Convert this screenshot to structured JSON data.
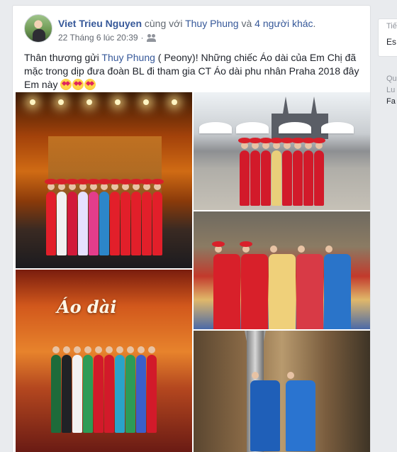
{
  "post": {
    "author": "Viet Trieu Nguyen",
    "with_text": " cùng với ",
    "tagged": "Thuy Phung",
    "and_text": " và ",
    "others": "4 người khác",
    "period": ".",
    "timestamp": "22 Tháng 6 lúc 20:39",
    "dot": " · ",
    "audience_icon": "friends-icon",
    "text_before": "Thân thương gửi ",
    "text_tag": "Thuy Phung",
    "text_after": " ( Peony)! Những chiếc Áo dài của Em Chị đã mặc trong dịp đưa đoàn BL đi tham gia CT Áo dài phu nhân Praha 2018 đây Em này ",
    "emoji_icon": "heart-eyes-emoji"
  },
  "photos": {
    "photo4_caption": "Áo dài"
  },
  "sidebar": {
    "t1": "Tiế",
    "t2": "Es",
    "t3a": "Qu",
    "t3b": "Lu",
    "t3c": "Fa"
  },
  "colors": {
    "link": "#365899",
    "meta": "#616770",
    "page_bg": "#e9ebee"
  }
}
